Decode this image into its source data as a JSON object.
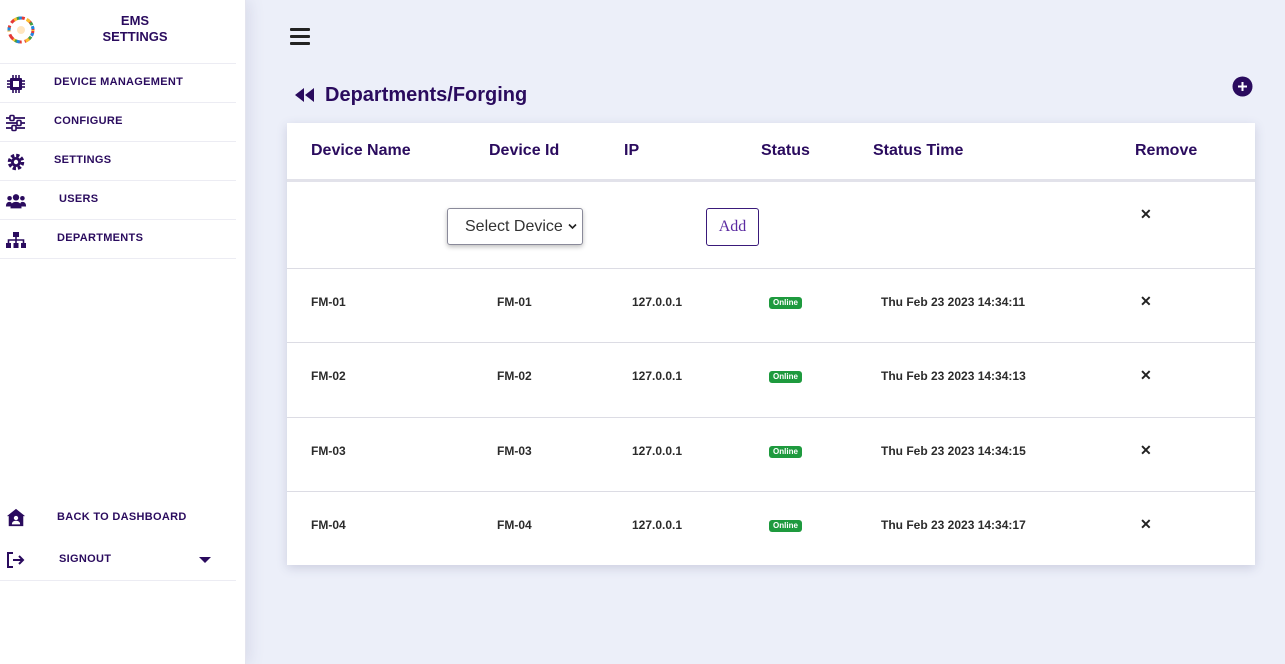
{
  "brand": {
    "line1": "EMS",
    "line2": "SETTINGS",
    "logo_icon": "gear-logo-icon"
  },
  "sidebar": {
    "items": [
      {
        "label": "DEVICE MANAGEMENT",
        "icon": "chip-icon"
      },
      {
        "label": "CONFIGURE",
        "icon": "sliders-icon"
      },
      {
        "label": "SETTINGS",
        "icon": "gear-icon"
      },
      {
        "label": "USERS",
        "icon": "users-icon"
      },
      {
        "label": "DEPARTMENTS",
        "icon": "sitemap-icon"
      }
    ],
    "bottom": [
      {
        "label": "BACK TO DASHBOARD",
        "icon": "house-user-icon"
      },
      {
        "label": "SIGNOUT",
        "icon": "sign-out-icon"
      }
    ]
  },
  "page": {
    "title": "Departments/Forging"
  },
  "table": {
    "headers": [
      "Device Name",
      "Device Id",
      "IP",
      "Status",
      "Status Time",
      "Remove"
    ],
    "add_row": {
      "select_placeholder": "Select Device",
      "add_label": "Add",
      "remove": "✕"
    },
    "rows": [
      {
        "name": "FM-01",
        "id": "FM-01",
        "ip": "127.0.0.1",
        "status": "Online",
        "time": "Thu Feb 23 2023 14:34:11",
        "remove": "✕"
      },
      {
        "name": "FM-02",
        "id": "FM-02",
        "ip": "127.0.0.1",
        "status": "Online",
        "time": "Thu Feb 23 2023 14:34:13",
        "remove": "✕"
      },
      {
        "name": "FM-03",
        "id": "FM-03",
        "ip": "127.0.0.1",
        "status": "Online",
        "time": "Thu Feb 23 2023 14:34:15",
        "remove": "✕"
      },
      {
        "name": "FM-04",
        "id": "FM-04",
        "ip": "127.0.0.1",
        "status": "Online",
        "time": "Thu Feb 23 2023 14:34:17",
        "remove": "✕"
      }
    ]
  },
  "colors": {
    "primary": "#2a0b5e",
    "online": "#1e9a3e",
    "background": "#eceff9"
  }
}
